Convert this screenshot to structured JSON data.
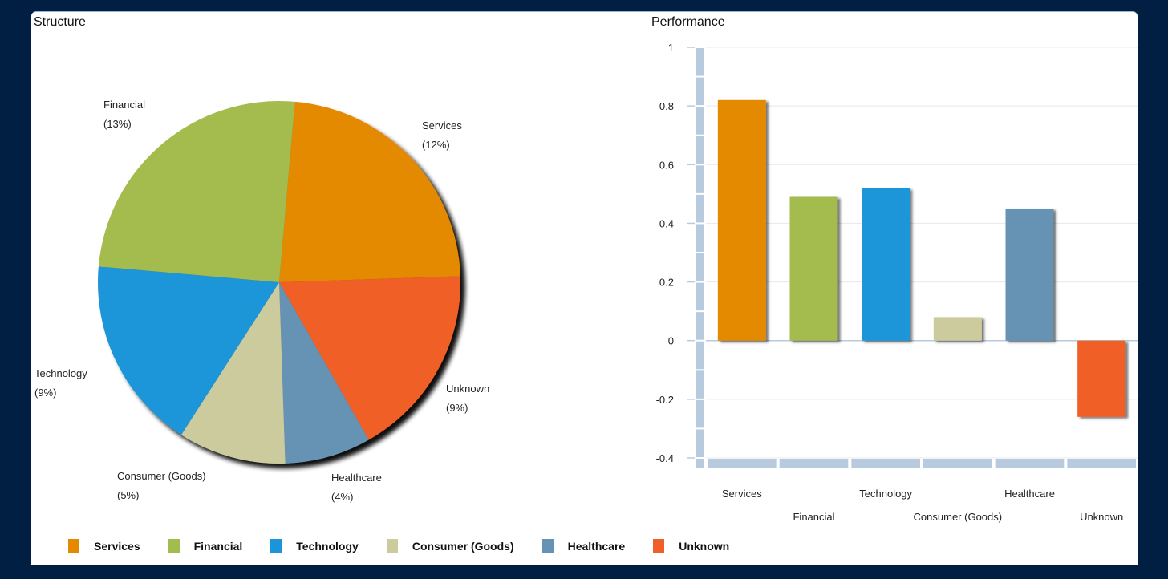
{
  "colors": {
    "Services": "#e38a00",
    "Financial": "#a3bc4e",
    "Technology": "#1b95d9",
    "Consumer (Goods)": "#cbcb9e",
    "Healthcare": "#6693b3",
    "Unknown": "#f05f28",
    "axis_band": "#b8cadd",
    "grid": "#e8e8e8"
  },
  "chart_data": [
    {
      "type": "pie",
      "title": "Structure",
      "categories": [
        "Services",
        "Unknown",
        "Healthcare",
        "Consumer (Goods)",
        "Technology",
        "Financial"
      ],
      "values": [
        12,
        9,
        4,
        5,
        9,
        13
      ],
      "labels": [
        "(12%)",
        "(9%)",
        "(4%)",
        "(5%)",
        "(9%)",
        "(13%)"
      ],
      "start_angle_deg": -85,
      "direction": "clockwise"
    },
    {
      "type": "bar",
      "title": "Performance",
      "categories": [
        "Services",
        "Financial",
        "Technology",
        "Consumer (Goods)",
        "Healthcare",
        "Unknown"
      ],
      "values": [
        0.82,
        0.49,
        0.52,
        0.08,
        0.45,
        -0.26
      ],
      "xlabel": "",
      "ylabel": "",
      "ylim": [
        -0.4,
        1
      ],
      "yticks": [
        1,
        0.8,
        0.6,
        0.4,
        0.2,
        0,
        -0.2,
        -0.4
      ],
      "ytick_labels": [
        "1",
        "0.8",
        "0.6",
        "0.4",
        "0.2",
        "0",
        "-0.2",
        "-0.4"
      ],
      "grid": true
    }
  ],
  "legend": {
    "position": "bottom",
    "items": [
      "Services",
      "Financial",
      "Technology",
      "Consumer (Goods)",
      "Healthcare",
      "Unknown"
    ]
  }
}
